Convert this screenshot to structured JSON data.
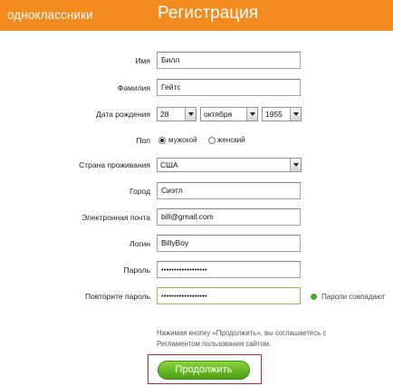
{
  "header": {
    "brand": "одноклассники",
    "title": "Регистрация",
    "accent_color": "#f28a1d"
  },
  "form": {
    "first_name": {
      "label": "Имя",
      "value": "Билл"
    },
    "last_name": {
      "label": "Фамилия",
      "value": "Гейтс"
    },
    "birth_date": {
      "label": "Дата рождения",
      "day": "28",
      "month": "октября",
      "year": "1955"
    },
    "gender": {
      "label": "Пол",
      "options": [
        "мужской",
        "женский"
      ],
      "selected": "мужской"
    },
    "country": {
      "label": "Страна проживания",
      "value": "США"
    },
    "city": {
      "label": "Город",
      "value": "Сиэтл"
    },
    "email": {
      "label": "Электронная почта",
      "value": "bill@gmail.com"
    },
    "login": {
      "label": "Логин",
      "value": "BillyBoy"
    },
    "password": {
      "label": "Пароль",
      "value": "••••••••••••••••••"
    },
    "password_repeat": {
      "label": "Повторите пароль",
      "value": "••••••••••••••••••"
    },
    "password_match_text": "Пароли совпадают",
    "terms_note": "Нажимая кнопку «Продолжить», вы соглашаетесь с Регламентом пользования сайтом.",
    "continue_label": "Продолжить"
  }
}
